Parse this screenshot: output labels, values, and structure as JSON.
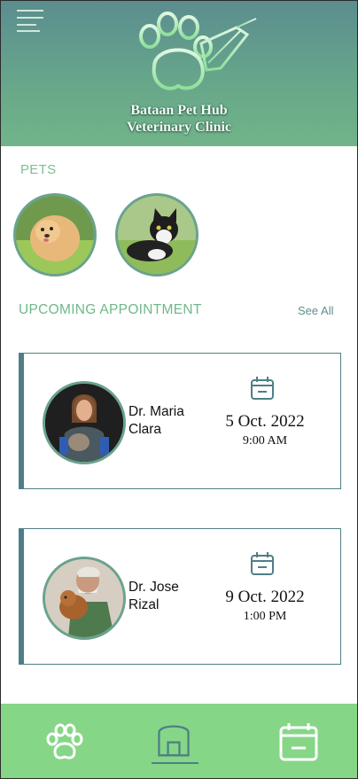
{
  "header": {
    "clinic_name_line1": "Bataan Pet Hub",
    "clinic_name_line2": "Veterinary Clinic",
    "menu_icon": "hamburger-menu-icon",
    "logo_icon": "paw-leaf-logo"
  },
  "pets": {
    "title": "PETS",
    "items": [
      {
        "name": "pomeranian-pet-photo"
      },
      {
        "name": "cat-pet-photo"
      }
    ]
  },
  "appointments": {
    "title": "UPCOMING APPOINTMENT",
    "see_all_label": "See All",
    "items": [
      {
        "doctor_line1": "Dr. Maria",
        "doctor_line2": "Clara",
        "date": "5 Oct. 2022",
        "time": "9:00 AM"
      },
      {
        "doctor_line1": "Dr. Jose",
        "doctor_line2": "Rizal",
        "date": "9 Oct. 2022",
        "time": "1:00 PM"
      }
    ]
  },
  "bottom_nav": {
    "items": [
      "paw-icon",
      "home-icon",
      "calendar-icon"
    ],
    "active": "home-icon"
  },
  "colors": {
    "header_top": "#5b8d8f",
    "header_bottom": "#71b489",
    "accent_green": "#7dc08f",
    "card_border": "#4f7f86",
    "nav_bg": "#86d687"
  }
}
